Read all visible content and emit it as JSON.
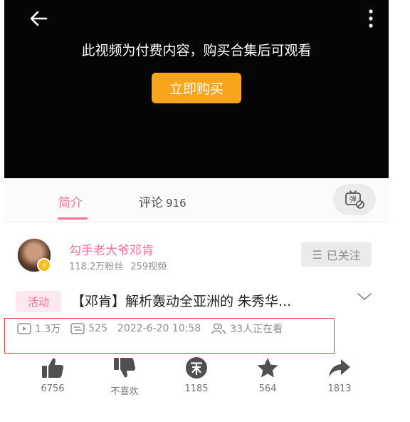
{
  "player": {
    "paywall_message": "此视频为付费内容，购买合集后可观看",
    "buy_label": "立即购买"
  },
  "tabs": {
    "intro_label": "简介",
    "comment_label": "评论",
    "comment_count": "916",
    "danmaku_icon": "danmaku-off-icon"
  },
  "uploader": {
    "name": "勾手老大爷邓肯",
    "followers": "118.2万粉丝",
    "videos": "259视频",
    "follow_label": "已关注"
  },
  "video": {
    "tag": "活动",
    "title": "【邓肯】解析轰动全亚洲的 朱秀华..."
  },
  "meta": {
    "plays": "1.3万",
    "danmaku": "525",
    "date": "2022-6-20 10:58",
    "watching": "33人正在看"
  },
  "actions": [
    {
      "name": "like",
      "label": "6756"
    },
    {
      "name": "dislike",
      "label": "不喜欢"
    },
    {
      "name": "coin",
      "label": "1185"
    },
    {
      "name": "favorite",
      "label": "564"
    },
    {
      "name": "share",
      "label": "1813"
    }
  ],
  "colors": {
    "brand_pink": "#fb7299",
    "buy_button": "#f9a51b",
    "highlight_box": "#e43b3b"
  }
}
